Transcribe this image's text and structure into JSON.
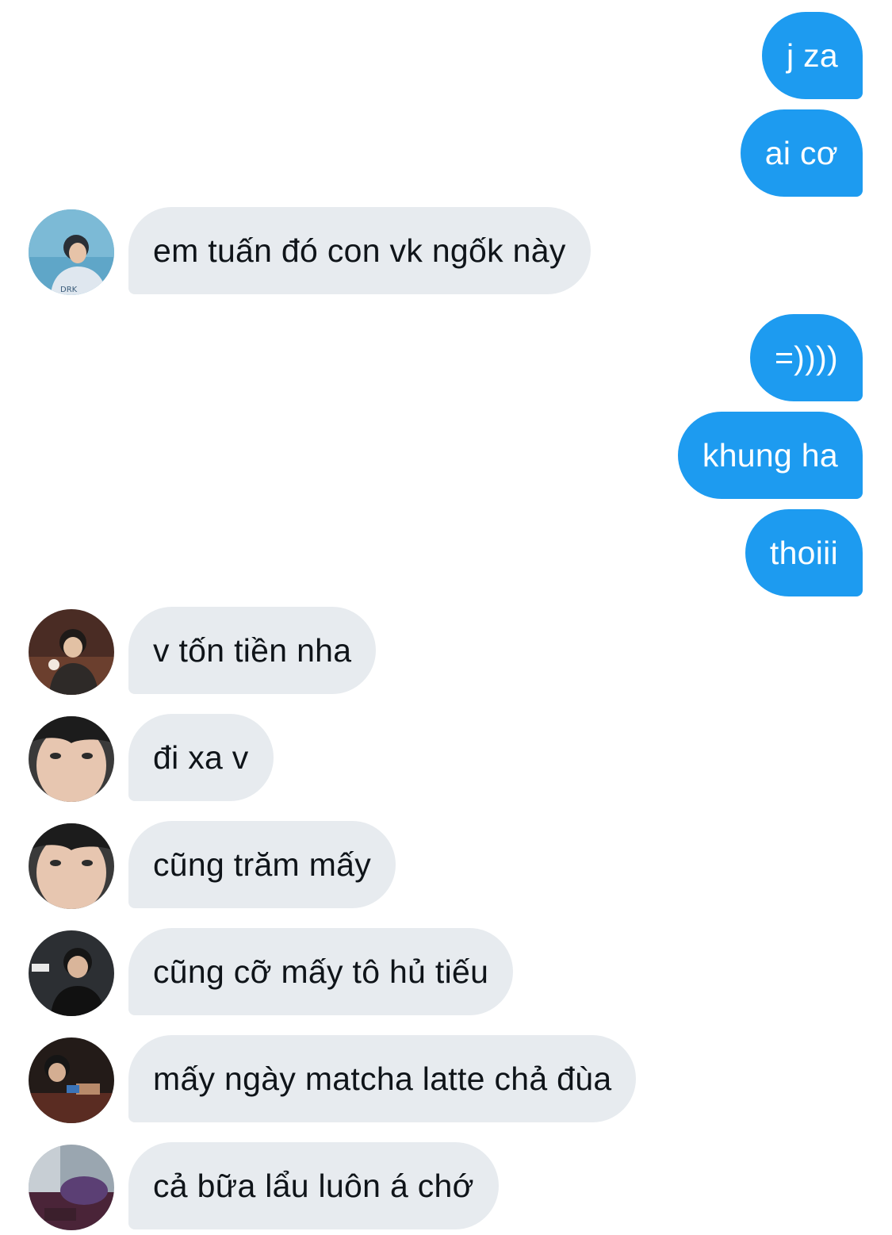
{
  "conversation": {
    "messages": [
      {
        "side": "out",
        "text": "j za"
      },
      {
        "side": "out",
        "text": "ai cơ"
      },
      {
        "side": "in",
        "text": "em tuấn đó con vk ngốk này"
      },
      {
        "side": "out",
        "text": "=))))"
      },
      {
        "side": "out",
        "text": "khung ha"
      },
      {
        "side": "out",
        "text": "thoiii"
      },
      {
        "side": "in",
        "text": "v tốn tiền nha"
      },
      {
        "side": "in",
        "text": "đi xa v"
      },
      {
        "side": "in",
        "text": "cũng trăm mấy"
      },
      {
        "side": "in",
        "text": "cũng cỡ mấy tô hủ tiếu"
      },
      {
        "side": "in",
        "text": "mấy ngày matcha latte chả đùa"
      },
      {
        "side": "in",
        "text": "cả bữa lẩu luôn á chớ"
      }
    ]
  },
  "colors": {
    "outgoing_bubble": "#1d9bf0",
    "incoming_bubble": "#e7ebef",
    "incoming_text": "#0f1419"
  }
}
